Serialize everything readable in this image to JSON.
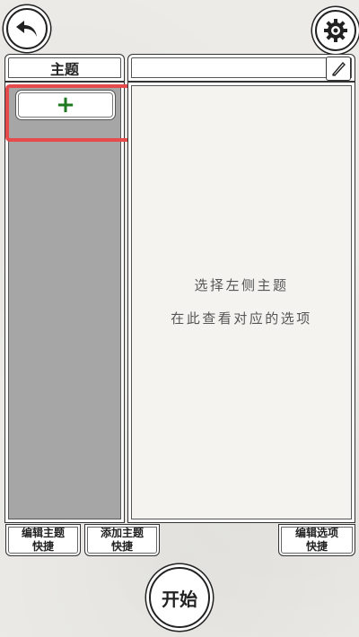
{
  "topbar": {
    "back_icon": "back-arrow-icon",
    "settings_icon": "gear-icon"
  },
  "topic_panel": {
    "header": "主题",
    "add_label": "+"
  },
  "options_panel": {
    "edit_icon": "pencil-icon",
    "hint_line1": "选择左侧主题",
    "hint_line2": "在此查看对应的选项"
  },
  "shortcuts": {
    "edit_topic_line1": "编辑主题",
    "edit_topic_line2": "快捷",
    "add_topic_line1": "添加主题",
    "add_topic_line2": "快捷",
    "edit_option_line1": "编辑选项",
    "edit_option_line2": "快捷"
  },
  "start_label": "开始",
  "colors": {
    "highlight": "#e74a4a",
    "add_plus": "#1f7a1f",
    "topic_list_bg": "#a6a6a6"
  }
}
